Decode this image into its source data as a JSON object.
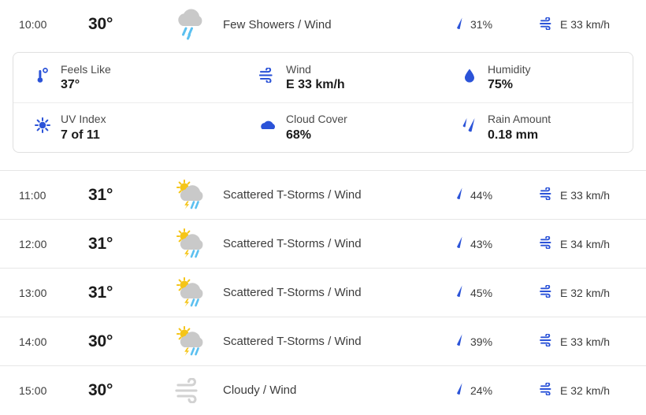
{
  "colors": {
    "accent_blue": "#2b53d8",
    "rain_blue": "#5bc0f0",
    "cloud_gray": "#c9c9c9",
    "sun_yellow": "#f5c518",
    "text": "#3c3c3c",
    "border": "#e6e6e6"
  },
  "hours": [
    {
      "time": "10:00",
      "temp": "30°",
      "icon": "rain-cloud-icon",
      "condition": "Few Showers / Wind",
      "precip_icon": "precip-drop-icon",
      "precip": "31%",
      "wind_icon": "wind-icon",
      "wind": "E 33 km/h",
      "expanded": true
    },
    {
      "time": "11:00",
      "temp": "31°",
      "icon": "sun-cloud-thunder-icon",
      "condition": "Scattered T-Storms / Wind",
      "precip_icon": "precip-drop-icon",
      "precip": "44%",
      "wind_icon": "wind-icon",
      "wind": "E 33 km/h",
      "expanded": false
    },
    {
      "time": "12:00",
      "temp": "31°",
      "icon": "sun-cloud-thunder-icon",
      "condition": "Scattered T-Storms / Wind",
      "precip_icon": "precip-drop-icon",
      "precip": "43%",
      "wind_icon": "wind-icon",
      "wind": "E 34 km/h",
      "expanded": false
    },
    {
      "time": "13:00",
      "temp": "31°",
      "icon": "sun-cloud-thunder-icon",
      "condition": "Scattered T-Storms / Wind",
      "precip_icon": "precip-drop-icon",
      "precip": "45%",
      "wind_icon": "wind-icon",
      "wind": "E 32 km/h",
      "expanded": false
    },
    {
      "time": "14:00",
      "temp": "30°",
      "icon": "sun-cloud-thunder-icon",
      "condition": "Scattered T-Storms / Wind",
      "precip_icon": "precip-drop-icon",
      "precip": "39%",
      "wind_icon": "wind-icon",
      "wind": "E 33 km/h",
      "expanded": false
    },
    {
      "time": "15:00",
      "temp": "30°",
      "icon": "wind-gray-icon",
      "condition": "Cloudy / Wind",
      "precip_icon": "precip-drop-icon",
      "precip": "24%",
      "wind_icon": "wind-icon",
      "wind": "E 32 km/h",
      "expanded": false
    }
  ],
  "details": {
    "feels_like": {
      "label": "Feels Like",
      "value": "37°",
      "icon": "thermometer-icon"
    },
    "wind": {
      "label": "Wind",
      "value": "E 33 km/h",
      "icon": "wind-icon"
    },
    "humidity": {
      "label": "Humidity",
      "value": "75%",
      "icon": "water-drop-icon"
    },
    "uv_index": {
      "label": "UV Index",
      "value": "7 of 11",
      "icon": "sun-uv-icon"
    },
    "cloud_cover": {
      "label": "Cloud Cover",
      "value": "68%",
      "icon": "cloud-icon"
    },
    "rain_amount": {
      "label": "Rain Amount",
      "value": "0.18 mm",
      "icon": "rain-drops-icon"
    }
  }
}
